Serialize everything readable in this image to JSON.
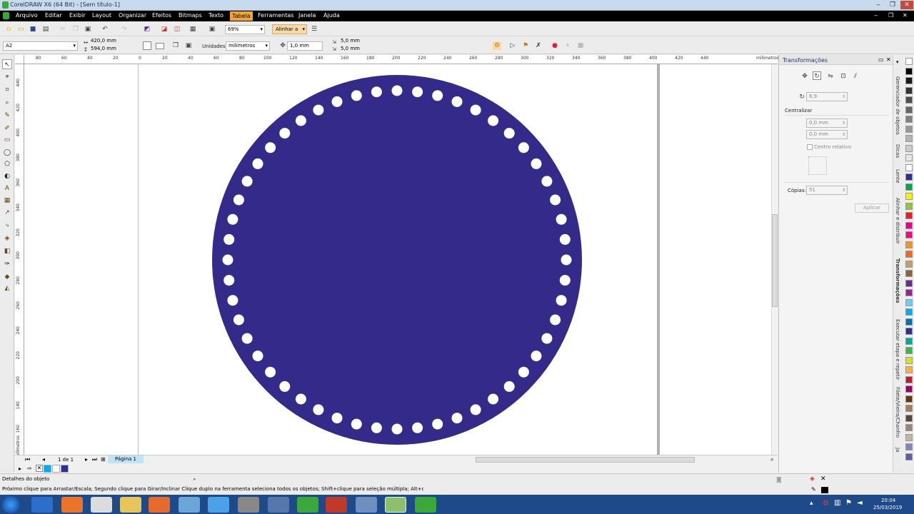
{
  "window": {
    "title": "CorelDRAW X6 (64 Bit) - [Sem título-1]"
  },
  "menu": [
    "Arquivo",
    "Editar",
    "Exibir",
    "Layout",
    "Organizar",
    "Efeitos",
    "Bitmaps",
    "Texto",
    "Tabela",
    "Ferramentas",
    "Janela",
    "Ajuda"
  ],
  "menu_active": "Tabela",
  "toolbar": {
    "zoom": "69%",
    "snap": "Alinhar a"
  },
  "propbar": {
    "page_size": "A2",
    "width": "420,0 mm",
    "height": "594,0 mm",
    "units_label": "Unidades:",
    "units": "milímetros",
    "nudge": "1,0 mm",
    "dup_x": "5,0 mm",
    "dup_y": "5,0 mm"
  },
  "ruler": {
    "top": [
      "80",
      "60",
      "40",
      "20",
      "0",
      "20",
      "40",
      "60",
      "80",
      "100",
      "120",
      "140",
      "160",
      "180",
      "200",
      "220",
      "240",
      "260",
      "280",
      "300",
      "320",
      "340",
      "360",
      "380",
      "400",
      "420",
      "440"
    ],
    "top_unit": "milímetros",
    "left": [
      "440",
      "420",
      "400",
      "380",
      "360",
      "340",
      "320",
      "300",
      "280",
      "260",
      "240",
      "220",
      "200",
      "180",
      "160",
      "140",
      "120",
      "100"
    ],
    "left_unit": "milímetros"
  },
  "pagenav": {
    "count": "1 de 1",
    "tab": "Página 1"
  },
  "panel": {
    "title": "Transformações",
    "angle": "6,9",
    "center_label": "Centralizar",
    "x": "0,0 mm",
    "y": "0,0 mm",
    "relative": "Centro relativo",
    "copies_label": "Cópias:",
    "copies": "51",
    "apply": "Aplicar"
  },
  "dock_tabs": [
    "Gerenciador de objetos",
    "Dicas",
    "Lente",
    "Alinhar e distribuir",
    "Transformações",
    "Executar etapa e repetir",
    "Filete/Vieira/Chanfro",
    "Ja"
  ],
  "status": {
    "details": "Detalhes do objeto",
    "hint": "Próximo clique para Arrastar/Escala; Segundo clique para Girar/Inclinar Clique duplo na ferramenta seleciona todos os objetos; Shift+clique para seleção múltipla; Alt+clique aprofunda"
  },
  "clock": {
    "time": "20:04",
    "date": "25/03/2019"
  },
  "colors": {
    "fill": "#332a8a",
    "hole": "#ffffff",
    "accent": "#f5a623"
  },
  "palette": [
    "#ffffff",
    "#000000",
    "#1a1a1a",
    "#333333",
    "#4d4d4d",
    "#666666",
    "#808080",
    "#999999",
    "#b3b3b3",
    "#cccccc",
    "#e6e6e6",
    "#ffffff",
    "#2e3192",
    "#00a651",
    "#fff200",
    "#8dc63f",
    "#ed1c24",
    "#ec008c",
    "#ff0080",
    "#f7941d",
    "#f26522",
    "#c69c6d",
    "#8c6239",
    "#662d91",
    "#92278f",
    "#6dcff6",
    "#00aeef",
    "#0072bc",
    "#2e3192",
    "#00a99d",
    "#39b54a",
    "#d7df23",
    "#fbb040",
    "#be1e2d",
    "#9e005d",
    "#603913",
    "#a67c52",
    "#534741",
    "#998675",
    "#c2b59b",
    "#8781bd",
    "#605ca8"
  ],
  "doc_colors": [
    "#00aeef",
    "#ffffff",
    "#2e3192"
  ],
  "holes": {
    "count": 52
  }
}
